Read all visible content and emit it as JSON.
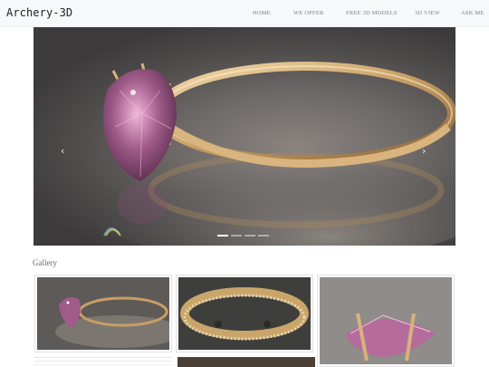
{
  "navbar": {
    "brand": "Archery-3D",
    "links": [
      {
        "label": "HOME"
      },
      {
        "label": "WE OFFER"
      },
      {
        "label": "FREE 3D MODELS"
      },
      {
        "label": "3D VIEW"
      },
      {
        "label": "ASK ME"
      }
    ]
  },
  "carousel": {
    "image": "gold-ring-with-pink-gemstone",
    "prev_icon": "chevron-left-icon",
    "next_icon": "chevron-right-icon",
    "prev_glyph": "‹",
    "next_glyph": "›",
    "slide_count": 4,
    "active_slide": 1
  },
  "gallery": {
    "title": "Gallery",
    "thumbnails": [
      {
        "image": "gold-ring-pink-gem-side"
      },
      {
        "image": "gold-band-with-diamonds"
      },
      {
        "image": "pink-gem-prongs-closeup"
      }
    ]
  },
  "colors": {
    "navbar_bg": "#f7f8fa",
    "gold": "#c9a16a",
    "gem": "#a35a8c"
  }
}
